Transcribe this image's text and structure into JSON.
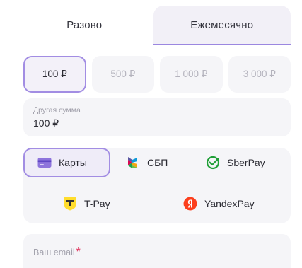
{
  "tabs": [
    {
      "label": "Разово",
      "active": false
    },
    {
      "label": "Ежемесячно",
      "active": true
    }
  ],
  "amounts": [
    {
      "label": "100 ₽",
      "selected": true
    },
    {
      "label": "500 ₽",
      "selected": false
    },
    {
      "label": "1 000 ₽",
      "selected": false
    },
    {
      "label": "3 000 ₽",
      "selected": false
    }
  ],
  "other_amount": {
    "label": "Другая сумма",
    "value": "100 ₽"
  },
  "payment_methods": [
    {
      "label": "Карты",
      "icon": "card-icon",
      "selected": true
    },
    {
      "label": "СБП",
      "icon": "sbp-logo-icon",
      "selected": false
    },
    {
      "label": "SberPay",
      "icon": "sberpay-logo-icon",
      "selected": false
    },
    {
      "label": "T-Pay",
      "icon": "tpay-logo-icon",
      "selected": false
    },
    {
      "label": "YandexPay",
      "icon": "yandexpay-logo-icon",
      "selected": false
    }
  ],
  "email": {
    "label": "Ваш email",
    "required_mark": "*"
  },
  "colors": {
    "accent": "#a28de3",
    "field_bg": "#f5f5f8",
    "required": "#e0365f"
  }
}
